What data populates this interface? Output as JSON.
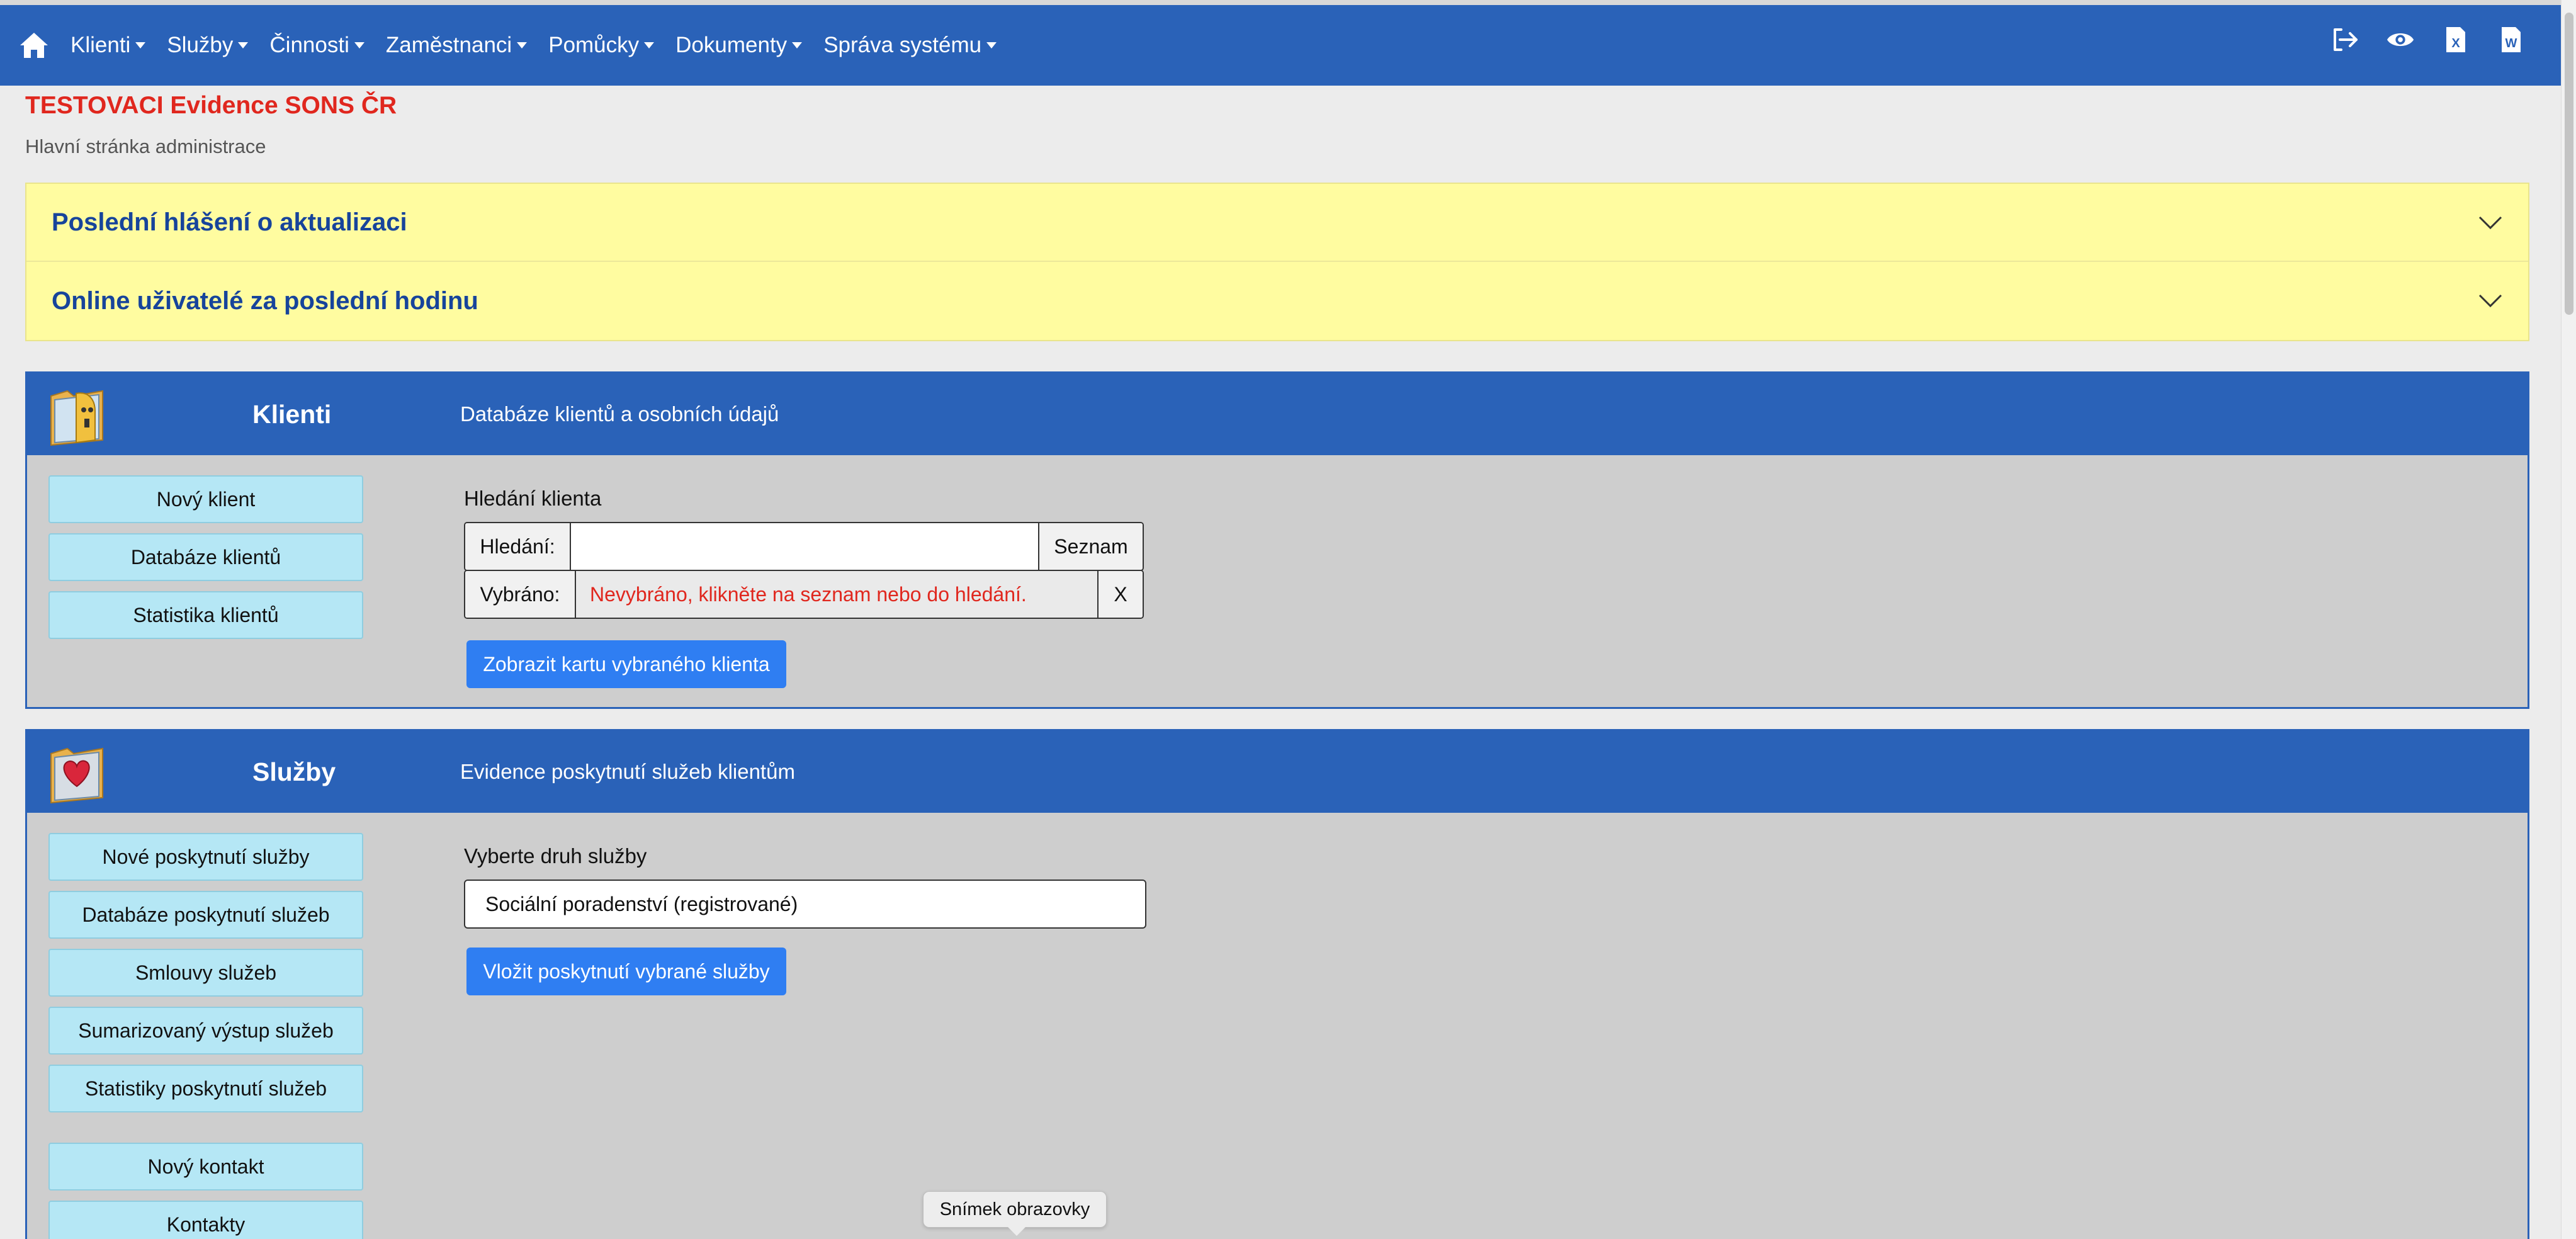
{
  "nav": {
    "items": [
      {
        "label": "Klienti"
      },
      {
        "label": "Služby"
      },
      {
        "label": "Činnosti"
      },
      {
        "label": "Zaměstnanci"
      },
      {
        "label": "Pomůcky"
      },
      {
        "label": "Dokumenty"
      },
      {
        "label": "Správa systému"
      }
    ],
    "right_icons": [
      "logout-icon",
      "eye-icon",
      "excel-icon",
      "word-icon"
    ]
  },
  "header": {
    "title": "TESTOVACI Evidence SONS ČR",
    "subtitle": "Hlavní stránka administrace"
  },
  "accordion": [
    {
      "label": "Poslední hlášení o aktualizaci"
    },
    {
      "label": "Online uživatelé za poslední hodinu"
    }
  ],
  "clients_panel": {
    "title": "Klienti",
    "description": "Databáze klientů a osobních údajů",
    "buttons": [
      "Nový klient",
      "Databáze klientů",
      "Statistika klientů"
    ],
    "search_heading": "Hledání klienta",
    "search_label": "Hledání:",
    "search_value": "",
    "list_button": "Seznam",
    "selected_label": "Vybráno:",
    "selected_value": "Nevybráno, klikněte na seznam nebo do hledání.",
    "clear_button": "X",
    "show_card_button": "Zobrazit kartu vybraného klienta"
  },
  "services_panel": {
    "title": "Služby",
    "description": "Evidence poskytnutí služeb klientům",
    "buttons": [
      "Nové poskytnutí služby",
      "Databáze poskytnutí služeb",
      "Smlouvy služeb",
      "Sumarizovaný výstup služeb",
      "Statistiky poskytnutí služeb",
      "Nový kontakt",
      "Kontakty"
    ],
    "service_type_heading": "Vyberte druh služby",
    "service_type_value": "Sociální poradenství (registrované)",
    "insert_button": "Vložit poskytnutí vybrané služby"
  },
  "tooltip": {
    "text": "Snímek obrazovky"
  },
  "colors": {
    "navbar": "#2a62b8",
    "title_red": "#e0271e",
    "accordion_bg": "#fffca0",
    "side_button": "#b5e7f5",
    "primary_button": "#2f7ef2",
    "error_text": "#e0271e"
  }
}
